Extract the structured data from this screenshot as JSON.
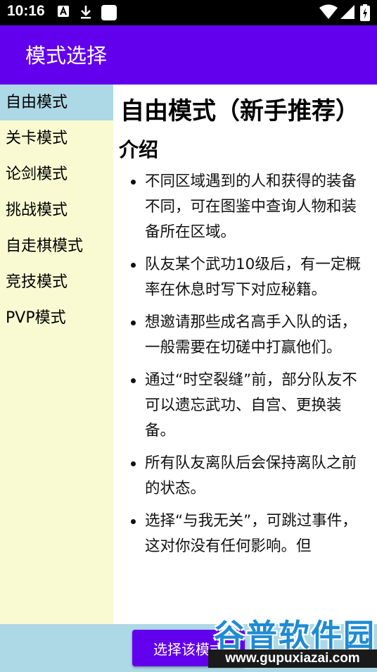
{
  "status_bar": {
    "time": "10:16",
    "notification_icons": [
      "a-app-icon",
      "download-icon",
      "blank-app-icon"
    ],
    "system_icons": [
      "wifi-icon",
      "signal-icon",
      "battery-icon"
    ]
  },
  "app_bar": {
    "title": "模式选择"
  },
  "sidebar": {
    "items": [
      {
        "label": "自由模式",
        "active": true
      },
      {
        "label": "关卡模式"
      },
      {
        "label": "论剑模式"
      },
      {
        "label": "挑战模式"
      },
      {
        "label": "自走棋模式"
      },
      {
        "label": "竞技模式"
      },
      {
        "label": "PVP模式"
      }
    ]
  },
  "content": {
    "mode_title": "自由模式（新手推荐）",
    "section_title": "介绍",
    "tips": [
      "不同区域遇到的人和获得的装备不同，可在图鉴中查询人物和装备所在区域。",
      "队友某个武功10级后，有一定概率在休息时写下对应秘籍。",
      "想邀请那些成名高手入队的话，一般需要在切磋中打赢他们。",
      "通过“时空裂缝”前，部分队友不可以遗忘武功、自宫、更换装备。",
      "所有队友离队后会保持离队之前的状态。",
      "选择“与我无关”，可跳过事件，这对你没有任何影响。但"
    ]
  },
  "bottom_bar": {
    "select_label": "选择该模式"
  },
  "watermark": {
    "brand": "谷普软件园",
    "url": "www.gupuxiazai.com"
  },
  "colors": {
    "app_bar": "#6200ee",
    "sidebar_bg": "#fafad2",
    "sidebar_active": "#add8e6",
    "bottom_bar": "#add8e6",
    "button": "#6200ee"
  }
}
